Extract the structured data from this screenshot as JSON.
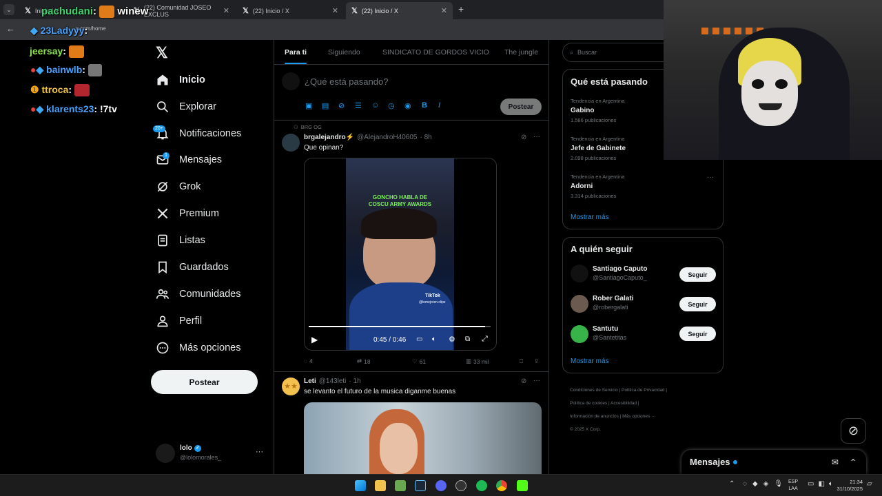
{
  "browser": {
    "tabs": [
      {
        "title": "Inicio / X",
        "active": false
      },
      {
        "title": "(22) Comunidad JOSEO EXCLUS",
        "active": false
      },
      {
        "title": "(22) Inicio / X",
        "active": false
      },
      {
        "title": "(22) Inicio / X",
        "active": true
      }
    ],
    "address": "x.com/home"
  },
  "chat_overlay": [
    {
      "user": "pachudani",
      "text": "winew",
      "color": "#3dd36b"
    },
    {
      "user": "23Ladyyy",
      "text": "",
      "color": "#4aa3ff"
    },
    {
      "user": "jeersay",
      "text": "",
      "color": "#8be34a"
    },
    {
      "user": "bainwlb",
      "text": "",
      "color": "#4aa3ff"
    },
    {
      "user": "ttroca",
      "text": "",
      "color": "#f4c542"
    },
    {
      "user": "klarents23",
      "text": "!7tv",
      "color": "#4aa3ff"
    }
  ],
  "nav": {
    "items": [
      {
        "label": "Inicio",
        "icon": "home-icon"
      },
      {
        "label": "Explorar",
        "icon": "search-icon"
      },
      {
        "label": "Notificaciones",
        "icon": "bell-icon",
        "badge": "20+"
      },
      {
        "label": "Mensajes",
        "icon": "mail-icon",
        "badge": "1"
      },
      {
        "label": "Grok",
        "icon": "grok-icon"
      },
      {
        "label": "Premium",
        "icon": "x-logo-icon"
      },
      {
        "label": "Listas",
        "icon": "list-icon"
      },
      {
        "label": "Guardados",
        "icon": "bookmark-icon"
      },
      {
        "label": "Comunidades",
        "icon": "communities-icon"
      },
      {
        "label": "Perfil",
        "icon": "profile-icon"
      },
      {
        "label": "Más opciones",
        "icon": "more-icon"
      }
    ],
    "post_button": "Postear",
    "account": {
      "name": "lolo",
      "handle": "@lolomorales_"
    }
  },
  "feed": {
    "tabs": [
      "Para ti",
      "Siguiendo",
      "SINDICATO DE GORDOS VICIO",
      "The jungle"
    ],
    "composer_placeholder": "¿Qué está pasando?",
    "composer_button": "Postear",
    "posts": [
      {
        "context": "BRG OG",
        "name": "brgalejandro⚡",
        "handle": "@AlejandroH40605",
        "time": "· 8h",
        "text": "Que opinan?",
        "video": {
          "caption_line1": "GONCHO HABLA DE",
          "caption_line2": "COSCU ARMY AWARDS",
          "watermark": "TikTok",
          "watermark_handle": "@lomejoren.clips",
          "time": "0:45 / 0:46",
          "progress": 0.97
        },
        "replies": "4",
        "reposts": "18",
        "likes": "61",
        "views": "33 mil"
      },
      {
        "name": "Leti",
        "handle": "@143leti",
        "time": "· 1h",
        "text": "se levanto el futuro de la  musica diganme buenas"
      }
    ]
  },
  "right": {
    "search_placeholder": "Buscar",
    "trends_title": "Qué está pasando",
    "trends": [
      {
        "context": "Tendencia en Argentina",
        "name": "Gabino",
        "count": "1.586 publicaciones"
      },
      {
        "context": "Tendencia en Argentina",
        "name": "Jefe de Gabinete",
        "count": "2.098 publicaciones"
      },
      {
        "context": "Tendencia en Argentina",
        "name": "Adorni",
        "count": "3.314 publicaciones"
      }
    ],
    "show_more": "Mostrar más",
    "follow_title": "A quién seguir",
    "follow": [
      {
        "name": "Santiago Caputo",
        "handle": "@SantiagoCaputo_",
        "button": "Seguir"
      },
      {
        "name": "Rober Galati",
        "handle": "@robergalati",
        "button": "Seguir"
      },
      {
        "name": "Santutu",
        "handle": "@Santetitas",
        "button": "Seguir"
      }
    ],
    "follow_more": "Mostrar más",
    "footer": [
      "Condiciones de Servicio",
      "Política de Privacidad",
      "Política de cookies",
      "Accesibilidad",
      "Información de anuncios",
      "Más opciones ···",
      "© 2025 X Corp."
    ]
  },
  "messages_bar": {
    "label": "Mensajes"
  },
  "taskbar": {
    "lang1": "ESP",
    "lang2": "LAA",
    "time": "21:34",
    "date": "31/10/2025"
  },
  "colors": {
    "accent": "#1d9bf0",
    "bg": "#000000",
    "border": "#2f3336",
    "muted": "#71767b"
  }
}
